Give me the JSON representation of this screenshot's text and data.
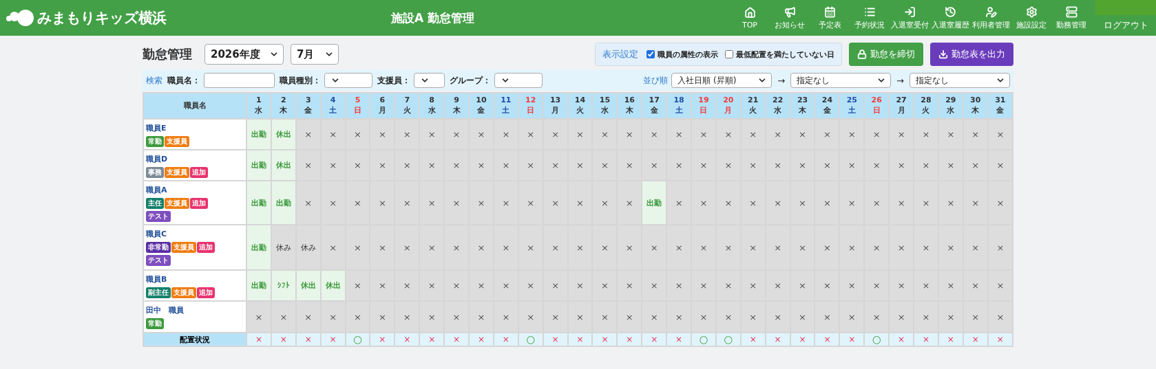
{
  "header": {
    "logo": "みまもりキッズ横浜",
    "title": "施設A 勤怠管理",
    "nav": [
      {
        "label": "TOP",
        "kind": "home"
      },
      {
        "label": "お知らせ",
        "kind": "megaphone"
      },
      {
        "label": "予定表",
        "kind": "calendar"
      },
      {
        "label": "予約状況",
        "kind": "list"
      },
      {
        "label": "入退室受付",
        "kind": "login"
      },
      {
        "label": "入退室履歴",
        "kind": "history"
      },
      {
        "label": "利用者管理",
        "kind": "user"
      },
      {
        "label": "施設設定",
        "kind": "gear"
      },
      {
        "label": "勤務管理",
        "kind": "server"
      }
    ],
    "logout": "ログアウト"
  },
  "toolbar": {
    "heading": "勤怠管理",
    "year": "2026年度",
    "month": "7月",
    "display": {
      "label": "表示設定",
      "options": [
        {
          "label": "職員の属性の表示",
          "checked": true
        },
        {
          "label": "最低配置を満たしていない日",
          "checked": false
        }
      ]
    },
    "buttons": [
      {
        "label": "勤怠を締切",
        "kind": "lock"
      },
      {
        "label": "勤怠表を出力",
        "kind": "download"
      }
    ]
  },
  "search": {
    "label": "検索",
    "fields": [
      {
        "label": "職員名：",
        "kind": "text"
      },
      {
        "label": "職員種別：",
        "kind": "select"
      },
      {
        "label": "支援員：",
        "kind": "select-small"
      },
      {
        "label": "グループ：",
        "kind": "select"
      }
    ],
    "sort": {
      "label": "並び順",
      "arrow": "→",
      "orders": [
        "入社日順 (昇順)",
        "指定なし",
        "指定なし"
      ]
    }
  },
  "table": {
    "name_header": "職員名",
    "days": [
      {
        "day": "1",
        "weekday": "水",
        "kind": "weekday"
      },
      {
        "day": "2",
        "weekday": "木",
        "kind": "weekday"
      },
      {
        "day": "3",
        "weekday": "金",
        "kind": "weekday"
      },
      {
        "day": "4",
        "weekday": "土",
        "kind": "saturday"
      },
      {
        "day": "5",
        "weekday": "日",
        "kind": "holiday"
      },
      {
        "day": "6",
        "weekday": "月",
        "kind": "weekday"
      },
      {
        "day": "7",
        "weekday": "火",
        "kind": "weekday"
      },
      {
        "day": "8",
        "weekday": "水",
        "kind": "weekday"
      },
      {
        "day": "9",
        "weekday": "木",
        "kind": "weekday"
      },
      {
        "day": "10",
        "weekday": "金",
        "kind": "weekday"
      },
      {
        "day": "11",
        "weekday": "土",
        "kind": "saturday"
      },
      {
        "day": "12",
        "weekday": "日",
        "kind": "holiday"
      },
      {
        "day": "13",
        "weekday": "月",
        "kind": "weekday"
      },
      {
        "day": "14",
        "weekday": "火",
        "kind": "weekday"
      },
      {
        "day": "15",
        "weekday": "水",
        "kind": "weekday"
      },
      {
        "day": "16",
        "weekday": "木",
        "kind": "weekday"
      },
      {
        "day": "17",
        "weekday": "金",
        "kind": "weekday"
      },
      {
        "day": "18",
        "weekday": "土",
        "kind": "saturday"
      },
      {
        "day": "19",
        "weekday": "日",
        "kind": "holiday"
      },
      {
        "day": "20",
        "weekday": "月",
        "kind": "holiday"
      },
      {
        "day": "21",
        "weekday": "火",
        "kind": "weekday"
      },
      {
        "day": "22",
        "weekday": "水",
        "kind": "weekday"
      },
      {
        "day": "23",
        "weekday": "木",
        "kind": "weekday"
      },
      {
        "day": "24",
        "weekday": "金",
        "kind": "weekday"
      },
      {
        "day": "25",
        "weekday": "土",
        "kind": "saturday"
      },
      {
        "day": "26",
        "weekday": "日",
        "kind": "holiday"
      },
      {
        "day": "27",
        "weekday": "月",
        "kind": "weekday"
      },
      {
        "day": "28",
        "weekday": "火",
        "kind": "weekday"
      },
      {
        "day": "29",
        "weekday": "水",
        "kind": "weekday"
      },
      {
        "day": "30",
        "weekday": "木",
        "kind": "weekday"
      },
      {
        "day": "31",
        "weekday": "金",
        "kind": "weekday"
      }
    ],
    "rows": [
      {
        "name": "職員E",
        "tags": [
          {
            "label": "常勤",
            "color": "#3d9a3d"
          },
          {
            "label": "支援員",
            "color": "#f07d12"
          }
        ],
        "cells": [
          {
            "text": "出勤",
            "kind": "work"
          },
          {
            "text": "休出",
            "kind": "work"
          },
          {
            "text": "×",
            "kind": "none"
          },
          {
            "text": "×",
            "kind": "none"
          },
          {
            "text": "×",
            "kind": "none"
          },
          {
            "text": "×",
            "kind": "none"
          },
          {
            "text": "×",
            "kind": "none"
          },
          {
            "text": "×",
            "kind": "none"
          },
          {
            "text": "×",
            "kind": "none"
          },
          {
            "text": "×",
            "kind": "none"
          },
          {
            "text": "×",
            "kind": "none"
          },
          {
            "text": "×",
            "kind": "none"
          },
          {
            "text": "×",
            "kind": "none"
          },
          {
            "text": "×",
            "kind": "none"
          },
          {
            "text": "×",
            "kind": "none"
          },
          {
            "text": "×",
            "kind": "none"
          },
          {
            "text": "×",
            "kind": "none"
          },
          {
            "text": "×",
            "kind": "none"
          },
          {
            "text": "×",
            "kind": "none"
          },
          {
            "text": "×",
            "kind": "none"
          },
          {
            "text": "×",
            "kind": "none"
          },
          {
            "text": "×",
            "kind": "none"
          },
          {
            "text": "×",
            "kind": "none"
          },
          {
            "text": "×",
            "kind": "none"
          },
          {
            "text": "×",
            "kind": "none"
          },
          {
            "text": "×",
            "kind": "none"
          },
          {
            "text": "×",
            "kind": "none"
          },
          {
            "text": "×",
            "kind": "none"
          },
          {
            "text": "×",
            "kind": "none"
          },
          {
            "text": "×",
            "kind": "none"
          },
          {
            "text": "×",
            "kind": "none"
          }
        ]
      },
      {
        "name": "職員D",
        "tags": [
          {
            "label": "事務",
            "color": "#7b8a96"
          },
          {
            "label": "支援員",
            "color": "#f07d12"
          },
          {
            "label": "追加",
            "color": "#e8336e"
          }
        ],
        "cells": [
          {
            "text": "出勤",
            "kind": "work"
          },
          {
            "text": "休出",
            "kind": "work"
          },
          {
            "text": "×",
            "kind": "none"
          },
          {
            "text": "×",
            "kind": "none"
          },
          {
            "text": "×",
            "kind": "none"
          },
          {
            "text": "×",
            "kind": "none"
          },
          {
            "text": "×",
            "kind": "none"
          },
          {
            "text": "×",
            "kind": "none"
          },
          {
            "text": "×",
            "kind": "none"
          },
          {
            "text": "×",
            "kind": "none"
          },
          {
            "text": "×",
            "kind": "none"
          },
          {
            "text": "×",
            "kind": "none"
          },
          {
            "text": "×",
            "kind": "none"
          },
          {
            "text": "×",
            "kind": "none"
          },
          {
            "text": "×",
            "kind": "none"
          },
          {
            "text": "×",
            "kind": "none"
          },
          {
            "text": "×",
            "kind": "none"
          },
          {
            "text": "×",
            "kind": "none"
          },
          {
            "text": "×",
            "kind": "none"
          },
          {
            "text": "×",
            "kind": "none"
          },
          {
            "text": "×",
            "kind": "none"
          },
          {
            "text": "×",
            "kind": "none"
          },
          {
            "text": "×",
            "kind": "none"
          },
          {
            "text": "×",
            "kind": "none"
          },
          {
            "text": "×",
            "kind": "none"
          },
          {
            "text": "×",
            "kind": "none"
          },
          {
            "text": "×",
            "kind": "none"
          },
          {
            "text": "×",
            "kind": "none"
          },
          {
            "text": "×",
            "kind": "none"
          },
          {
            "text": "×",
            "kind": "none"
          },
          {
            "text": "×",
            "kind": "none"
          }
        ]
      },
      {
        "name": "職員A",
        "tags": [
          {
            "label": "主任",
            "color": "#14806b"
          },
          {
            "label": "支援員",
            "color": "#f07d12"
          },
          {
            "label": "追加",
            "color": "#e8336e"
          },
          {
            "label": "テスト",
            "color": "#7e4fbf"
          }
        ],
        "cells": [
          {
            "text": "出勤",
            "kind": "work"
          },
          {
            "text": "出勤",
            "kind": "work"
          },
          {
            "text": "×",
            "kind": "none"
          },
          {
            "text": "×",
            "kind": "none"
          },
          {
            "text": "×",
            "kind": "none"
          },
          {
            "text": "×",
            "kind": "none"
          },
          {
            "text": "×",
            "kind": "none"
          },
          {
            "text": "×",
            "kind": "none"
          },
          {
            "text": "×",
            "kind": "none"
          },
          {
            "text": "×",
            "kind": "none"
          },
          {
            "text": "×",
            "kind": "none"
          },
          {
            "text": "×",
            "kind": "none"
          },
          {
            "text": "×",
            "kind": "none"
          },
          {
            "text": "×",
            "kind": "none"
          },
          {
            "text": "×",
            "kind": "none"
          },
          {
            "text": "×",
            "kind": "none"
          },
          {
            "text": "出勤",
            "kind": "work"
          },
          {
            "text": "×",
            "kind": "none"
          },
          {
            "text": "×",
            "kind": "none"
          },
          {
            "text": "×",
            "kind": "none"
          },
          {
            "text": "×",
            "kind": "none"
          },
          {
            "text": "×",
            "kind": "none"
          },
          {
            "text": "×",
            "kind": "none"
          },
          {
            "text": "×",
            "kind": "none"
          },
          {
            "text": "×",
            "kind": "none"
          },
          {
            "text": "×",
            "kind": "none"
          },
          {
            "text": "×",
            "kind": "none"
          },
          {
            "text": "×",
            "kind": "none"
          },
          {
            "text": "×",
            "kind": "none"
          },
          {
            "text": "×",
            "kind": "none"
          },
          {
            "text": "×",
            "kind": "none"
          }
        ]
      },
      {
        "name": "職員C",
        "tags": [
          {
            "label": "非常勤",
            "color": "#5a2fa6"
          },
          {
            "label": "支援員",
            "color": "#f07d12"
          },
          {
            "label": "追加",
            "color": "#e8336e"
          },
          {
            "label": "テスト",
            "color": "#7e4fbf"
          }
        ],
        "cells": [
          {
            "text": "出勤",
            "kind": "work"
          },
          {
            "text": "休み",
            "kind": "off"
          },
          {
            "text": "休み",
            "kind": "off"
          },
          {
            "text": "×",
            "kind": "none"
          },
          {
            "text": "×",
            "kind": "none"
          },
          {
            "text": "×",
            "kind": "none"
          },
          {
            "text": "×",
            "kind": "none"
          },
          {
            "text": "×",
            "kind": "none"
          },
          {
            "text": "×",
            "kind": "none"
          },
          {
            "text": "×",
            "kind": "none"
          },
          {
            "text": "×",
            "kind": "none"
          },
          {
            "text": "×",
            "kind": "none"
          },
          {
            "text": "×",
            "kind": "none"
          },
          {
            "text": "×",
            "kind": "none"
          },
          {
            "text": "×",
            "kind": "none"
          },
          {
            "text": "×",
            "kind": "none"
          },
          {
            "text": "×",
            "kind": "none"
          },
          {
            "text": "×",
            "kind": "none"
          },
          {
            "text": "×",
            "kind": "none"
          },
          {
            "text": "×",
            "kind": "none"
          },
          {
            "text": "×",
            "kind": "none"
          },
          {
            "text": "×",
            "kind": "none"
          },
          {
            "text": "×",
            "kind": "none"
          },
          {
            "text": "×",
            "kind": "none"
          },
          {
            "text": "×",
            "kind": "none"
          },
          {
            "text": "×",
            "kind": "none"
          },
          {
            "text": "×",
            "kind": "none"
          },
          {
            "text": "×",
            "kind": "none"
          },
          {
            "text": "×",
            "kind": "none"
          },
          {
            "text": "×",
            "kind": "none"
          },
          {
            "text": "×",
            "kind": "none"
          }
        ]
      },
      {
        "name": "職員B",
        "tags": [
          {
            "label": "副主任",
            "color": "#14806b"
          },
          {
            "label": "支援員",
            "color": "#f07d12"
          },
          {
            "label": "追加",
            "color": "#e8336e"
          }
        ],
        "cells": [
          {
            "text": "出勤",
            "kind": "work"
          },
          {
            "text": "ｼﾌﾄ",
            "kind": "work"
          },
          {
            "text": "休出",
            "kind": "work"
          },
          {
            "text": "休出",
            "kind": "work"
          },
          {
            "text": "×",
            "kind": "none"
          },
          {
            "text": "×",
            "kind": "none"
          },
          {
            "text": "×",
            "kind": "none"
          },
          {
            "text": "×",
            "kind": "none"
          },
          {
            "text": "×",
            "kind": "none"
          },
          {
            "text": "×",
            "kind": "none"
          },
          {
            "text": "×",
            "kind": "none"
          },
          {
            "text": "×",
            "kind": "none"
          },
          {
            "text": "×",
            "kind": "none"
          },
          {
            "text": "×",
            "kind": "none"
          },
          {
            "text": "×",
            "kind": "none"
          },
          {
            "text": "×",
            "kind": "none"
          },
          {
            "text": "×",
            "kind": "none"
          },
          {
            "text": "×",
            "kind": "none"
          },
          {
            "text": "×",
            "kind": "none"
          },
          {
            "text": "×",
            "kind": "none"
          },
          {
            "text": "×",
            "kind": "none"
          },
          {
            "text": "×",
            "kind": "none"
          },
          {
            "text": "×",
            "kind": "none"
          },
          {
            "text": "×",
            "kind": "none"
          },
          {
            "text": "×",
            "kind": "none"
          },
          {
            "text": "×",
            "kind": "none"
          },
          {
            "text": "×",
            "kind": "none"
          },
          {
            "text": "×",
            "kind": "none"
          },
          {
            "text": "×",
            "kind": "none"
          },
          {
            "text": "×",
            "kind": "none"
          },
          {
            "text": "×",
            "kind": "none"
          }
        ]
      },
      {
        "name": "田中　職員",
        "tags": [
          {
            "label": "常勤",
            "color": "#3d9a3d"
          }
        ],
        "cells": [
          {
            "text": "×",
            "kind": "none"
          },
          {
            "text": "×",
            "kind": "none"
          },
          {
            "text": "×",
            "kind": "none"
          },
          {
            "text": "×",
            "kind": "none"
          },
          {
            "text": "×",
            "kind": "none"
          },
          {
            "text": "×",
            "kind": "none"
          },
          {
            "text": "×",
            "kind": "none"
          },
          {
            "text": "×",
            "kind": "none"
          },
          {
            "text": "×",
            "kind": "none"
          },
          {
            "text": "×",
            "kind": "none"
          },
          {
            "text": "×",
            "kind": "none"
          },
          {
            "text": "×",
            "kind": "none"
          },
          {
            "text": "×",
            "kind": "none"
          },
          {
            "text": "×",
            "kind": "none"
          },
          {
            "text": "×",
            "kind": "none"
          },
          {
            "text": "×",
            "kind": "none"
          },
          {
            "text": "×",
            "kind": "none"
          },
          {
            "text": "×",
            "kind": "none"
          },
          {
            "text": "×",
            "kind": "none"
          },
          {
            "text": "×",
            "kind": "none"
          },
          {
            "text": "×",
            "kind": "none"
          },
          {
            "text": "×",
            "kind": "none"
          },
          {
            "text": "×",
            "kind": "none"
          },
          {
            "text": "×",
            "kind": "none"
          },
          {
            "text": "×",
            "kind": "none"
          },
          {
            "text": "×",
            "kind": "none"
          },
          {
            "text": "×",
            "kind": "none"
          },
          {
            "text": "×",
            "kind": "none"
          },
          {
            "text": "×",
            "kind": "none"
          },
          {
            "text": "×",
            "kind": "none"
          },
          {
            "text": "×",
            "kind": "none"
          }
        ]
      }
    ],
    "footer": {
      "label": "配置状況",
      "status": [
        {
          "text": "×",
          "met": false
        },
        {
          "text": "×",
          "met": false
        },
        {
          "text": "×",
          "met": false
        },
        {
          "text": "×",
          "met": false
        },
        {
          "text": "○",
          "met": true
        },
        {
          "text": "×",
          "met": false
        },
        {
          "text": "×",
          "met": false
        },
        {
          "text": "×",
          "met": false
        },
        {
          "text": "×",
          "met": false
        },
        {
          "text": "×",
          "met": false
        },
        {
          "text": "×",
          "met": false
        },
        {
          "text": "○",
          "met": true
        },
        {
          "text": "×",
          "met": false
        },
        {
          "text": "×",
          "met": false
        },
        {
          "text": "×",
          "met": false
        },
        {
          "text": "×",
          "met": false
        },
        {
          "text": "×",
          "met": false
        },
        {
          "text": "×",
          "met": false
        },
        {
          "text": "○",
          "met": true
        },
        {
          "text": "○",
          "met": true
        },
        {
          "text": "×",
          "met": false
        },
        {
          "text": "×",
          "met": false
        },
        {
          "text": "×",
          "met": false
        },
        {
          "text": "×",
          "met": false
        },
        {
          "text": "×",
          "met": false
        },
        {
          "text": "○",
          "met": true
        },
        {
          "text": "×",
          "met": false
        },
        {
          "text": "×",
          "met": false
        },
        {
          "text": "×",
          "met": false
        },
        {
          "text": "×",
          "met": false
        },
        {
          "text": "×",
          "met": false
        }
      ]
    }
  }
}
